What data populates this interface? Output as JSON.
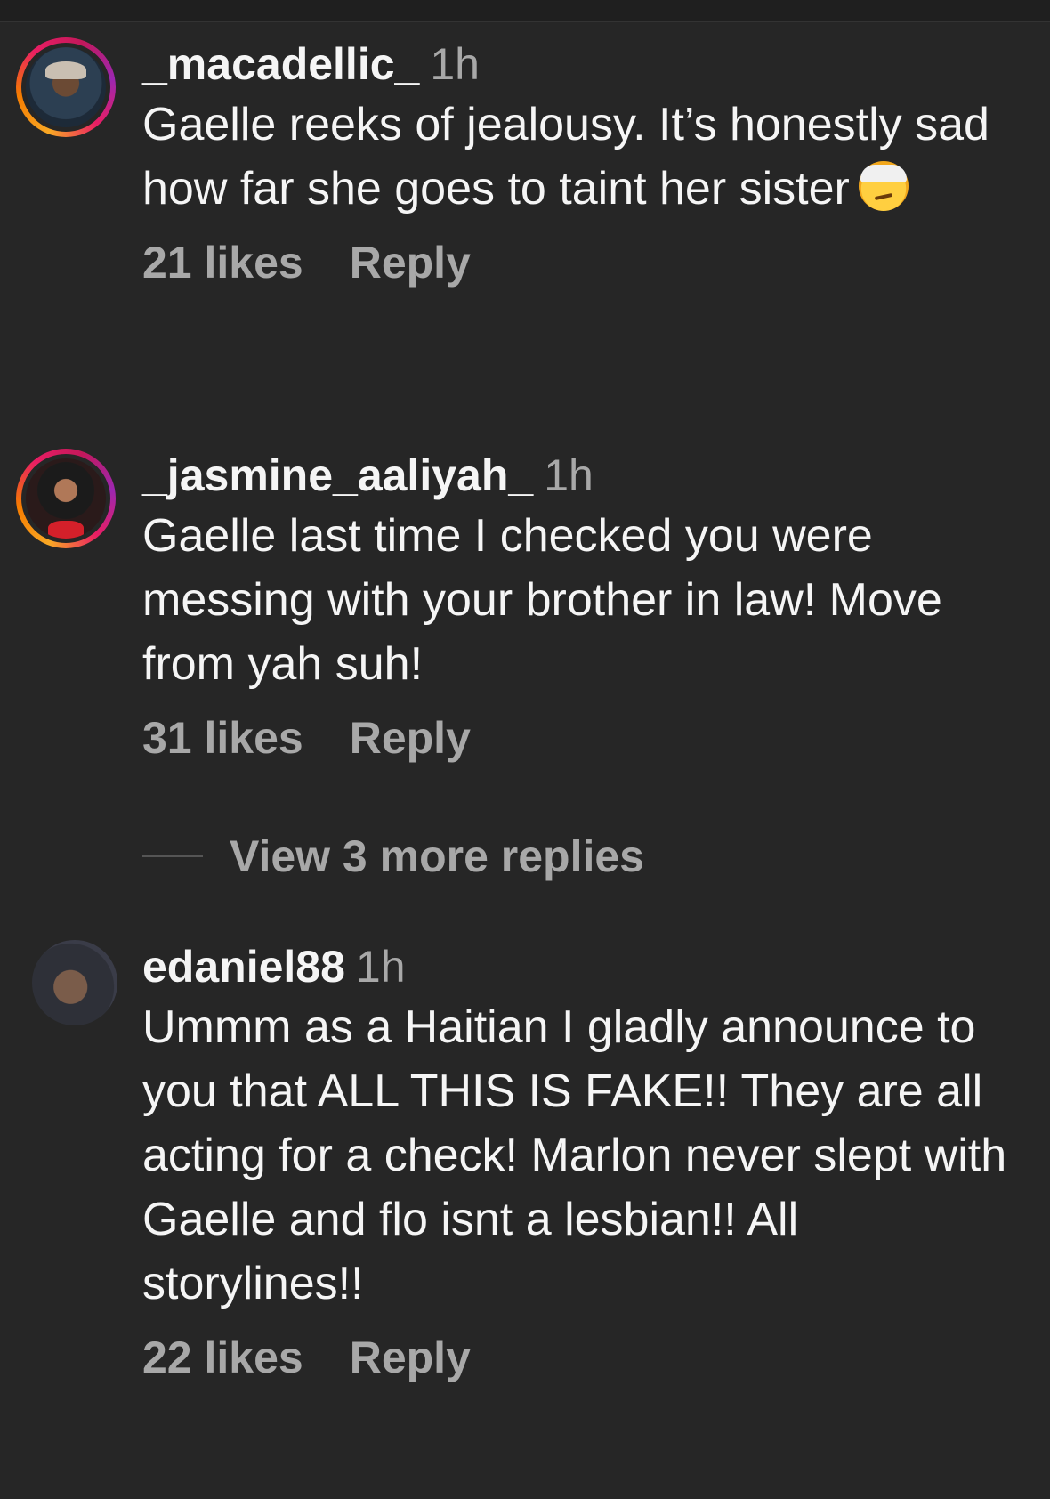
{
  "comments": [
    {
      "username": "_macadellic_",
      "time": "1h",
      "text": "Gaelle reeks of jealousy. It’s honestly sad how far she goes to taint her sister",
      "emoji": "face-with-head-bandage",
      "likes": "21 likes",
      "reply": "Reply"
    },
    {
      "username": "_jasmine_aaliyah_",
      "time": "1h",
      "text": "Gaelle last  time I checked you were messing with your brother in law! Move from yah suh!",
      "likes": "31 likes",
      "reply": "Reply"
    },
    {
      "username": "edaniel88",
      "time": "1h",
      "text": "Ummm as a Haitian I gladly announce to you that ALL THIS IS FAKE!! They are all acting for a check! Marlon never slept with Gaelle and flo isnt a lesbian!! All storylines!!",
      "likes": "22 likes",
      "reply": "Reply"
    }
  ],
  "view_more_replies": "View 3 more replies"
}
